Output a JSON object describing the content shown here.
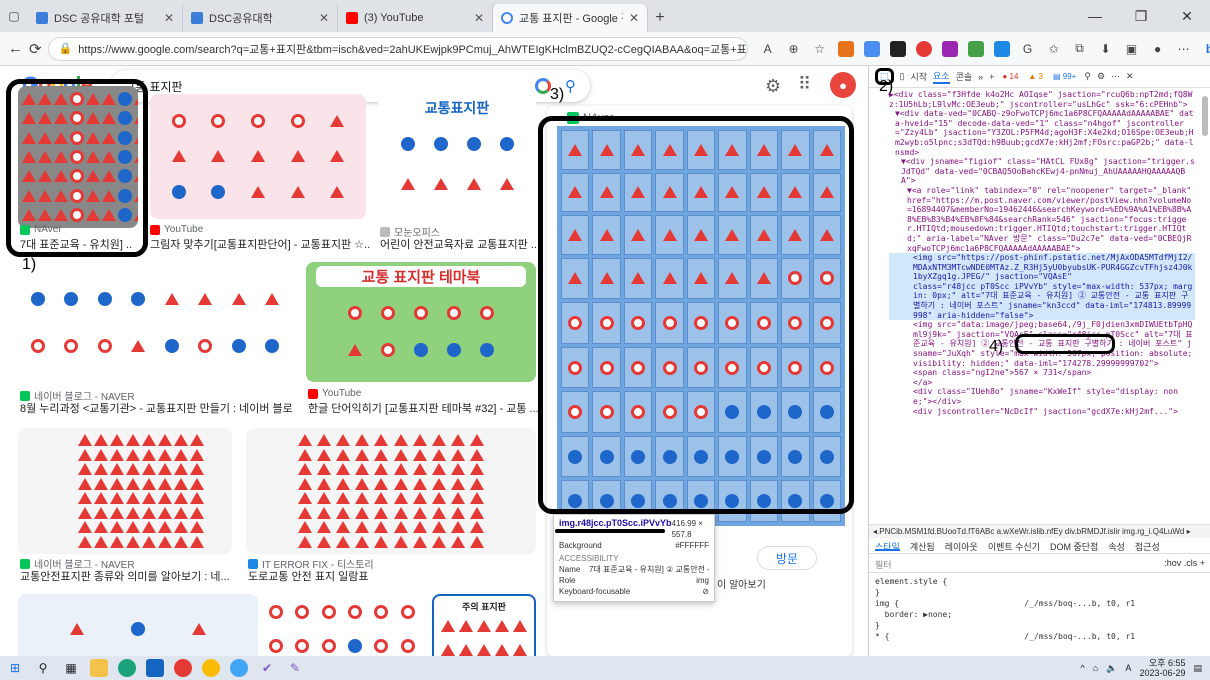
{
  "tabs": [
    {
      "label": "DSC 공유대학 포털",
      "color": "#3b7dd8"
    },
    {
      "label": "DSC공유대학",
      "color": "#3b7dd8"
    },
    {
      "label": "(3) YouTube",
      "color": "#ff0000"
    },
    {
      "label": "교통 표지판 - Google 검색",
      "color": "#4285f4"
    }
  ],
  "url": "https://www.google.com/search?q=교통+표지판&tbm=isch&ved=2ahUKEwjpk9PCmuj_AhWTEIgKHclmBZUQ2-cCegQIABAA&oq=교통+표지판&gs_lcp=...",
  "search": {
    "query": "교통 표지판"
  },
  "results": [
    {
      "source": "NAver",
      "title": "7대 표준교육 - 유치원] ..."
    },
    {
      "source": "YouTube",
      "title": "그림자 맞추기[교통표지판단어] - 교통표지판 ☆..."
    },
    {
      "source": "모눈오피스",
      "title": "어린이 안전교육자료 교통표지판 ..."
    },
    {
      "source": "네이버 블로그 - NAVER",
      "title": "8월 누리과정 <교통기관> - 교통표지판 만들기 : 네이버 블로..."
    },
    {
      "source": "YouTube",
      "title": "한글 단어익히기 [교통표지판 테마북 #32] - 교통 ..."
    },
    {
      "source": "네이버 블로그 - NAVER",
      "title": "교통안전표지판 종류와 의미를 알아보기 : 네..."
    },
    {
      "source": "IT ERROR FIX - 티스토리",
      "title": "도로교통 안전 표지 일람표"
    }
  ],
  "card_titles": {
    "traffic_sign": "교통표지판",
    "theme_book": "교통 표지판 테마북",
    "caution_sign": "주의 표지판"
  },
  "preview": {
    "source": "NAver",
    "visit_label": "방문",
    "side_text": "이 알아보기"
  },
  "annotations": [
    "1)",
    "2)",
    "3)",
    "4)"
  ],
  "tooltip": {
    "class_name": "img.r48jcc.pT0Scc.iPVvYb",
    "size": "416.99 × 557.8",
    "background_label": "Background",
    "background_value": "#FFFFFF",
    "accessibility_label": "ACCESSIBILITY",
    "name_label": "Name",
    "name_value": "7대 표준교육 - 유치원] ② 교통안전 -...",
    "role_label": "Role",
    "role_value": "img",
    "focus_label": "Keyboard-focusable"
  },
  "devtools": {
    "tabs": [
      "시작",
      "요소",
      "콘솔"
    ],
    "badges": {
      "errors": "14",
      "warnings": "3",
      "info": "99+"
    },
    "dom_lines": [
      "▶<div class=\"f3Hfde k4o2Hc AOIqse\" jsaction=\"rcuQ6b:npT2md;fQ8Wz:1U5hLb;L9lvMc:OE3eub;\" jscontroller=\"usLhGc\" ssk=\"6:cPEHnb\">",
      "▼<div data-ved=\"0CABQ-z9oFwoTCPj6mc1a6P8CFQAAAAAdAAAAABAE\" data-hveid=\"15\" decode-data-ved=\"1\" class=\"n4hgof\" jscontroller=\"Zzy4Lb\" jsaction=\"Y3ZOL:P5FM4d;agoH3F:X4e2kd;O16Spe:OE3eub;Hm2wyb:o5lpnc;s3dTQd:h9Buub;gcdX7e:kHj2mf;FOsrc:paGP2b;\" data-lnsmd>",
      "▼<div jsname=\"figiof\" class=\"HAtCL FUx8g\" jsaction=\"trigger.sJdTQd\" data-ved=\"0CBAQ5OoBahcKEwj4-pnNmuj_AhUAAAAAHQAAAAAQBA\">",
      "▼<a role=\"link\" tabindex=\"0\" rel=\"noopener\" target=\"_blank\" href=\"https://m.post.naver.com/viewer/postView.nhn?volumeNo=16894407&memberNo=19462446&searchKeyword=%ED%9A%A1%EB%8B%A8%EB%B3%B4%EB%8F%84&searchRank=546\" jsaction=\"focus:trigger.HTIQtd;mousedown:trigger.HTIQtd;touchstart:trigger.HTIQtd;\" aria-label=\"NAver 방문\" class=\"Du2c7e\" data-ved=\"0CBEQjRxqFwoTCPj6mc1a6P8CFQAAAAAdAAAAABAE\">",
      "<img src=\"https://post-phinf.pstatic.net/MjAxODA5MTdfMjI2/MDAxNTM3MTcwNDE0MTAz.Z_R3Hj5yU0byubsUK-PUR4GGZcvTFhjsz4J0k1byXZgq1g.JPEG/\" jsaction=\"VQAsE\"",
      "class=\"r48jcc pT0Scc iPVvYb\" style=\"max-width: 537px; margin: 0px;\" alt=\"7대 표준교육 - 유치원] ② 교통안전 - 교통 표지판 구별하기 : 네이버 포스트\" jsname=\"kn3ccd\" data-iml=\"174813.89999998\" aria-hidden=\"false\">",
      "<img src=\"data:image/jpeg;base64,/9j_F0jdien3xmDIWUEtbTpHQml9j9k=\" jsaction=\"VQAsE\" class=\"r48jcc pT0Scc\" alt=\"7대 표준교육 - 유치원] ② 교통안전 - 교통 표지판 구별하기 : 네이버 포스트\" jsname=\"JuXqh\" style=\"max-width: 567px; position: absolute; visibility: hidden;\" data-iml=\"174278.29999999702\">",
      "<span class=\"ngI2ne\">567 × 731</span>",
      "</a>",
      "<div class=\"IUeh8o\" jsname=\"KxWeIf\" style=\"display: none;\"></div>",
      "<div jscontroller=\"NcDcIf\" jsaction=\"gcdX7e:kHj2mf...\">"
    ],
    "breadcrumbs": "◂.PNCib.MSM1fd.BUooTd.fT6ABc  a.wXeWr.islib.nfEy  div.bRMDJf.islir  img.rg_i.Q4LuWd ▸",
    "style_tabs": [
      "스타일",
      "계산됨",
      "레이아웃",
      "이벤트 수신기",
      "DOM 중단점",
      "속성",
      "접근성"
    ],
    "filter_label": "필터",
    "filter_tools": ":hov  .cls  +",
    "styles": [
      "element.style {",
      "}",
      "img {                          /_/mss/boq-...b, t0, r1",
      "  border: ▶none;",
      "}",
      "* {                            /_/mss/boq-...b, t0, r1"
    ]
  },
  "taskbar": {
    "time": "오후 6:55",
    "date": "2023-06-29"
  }
}
